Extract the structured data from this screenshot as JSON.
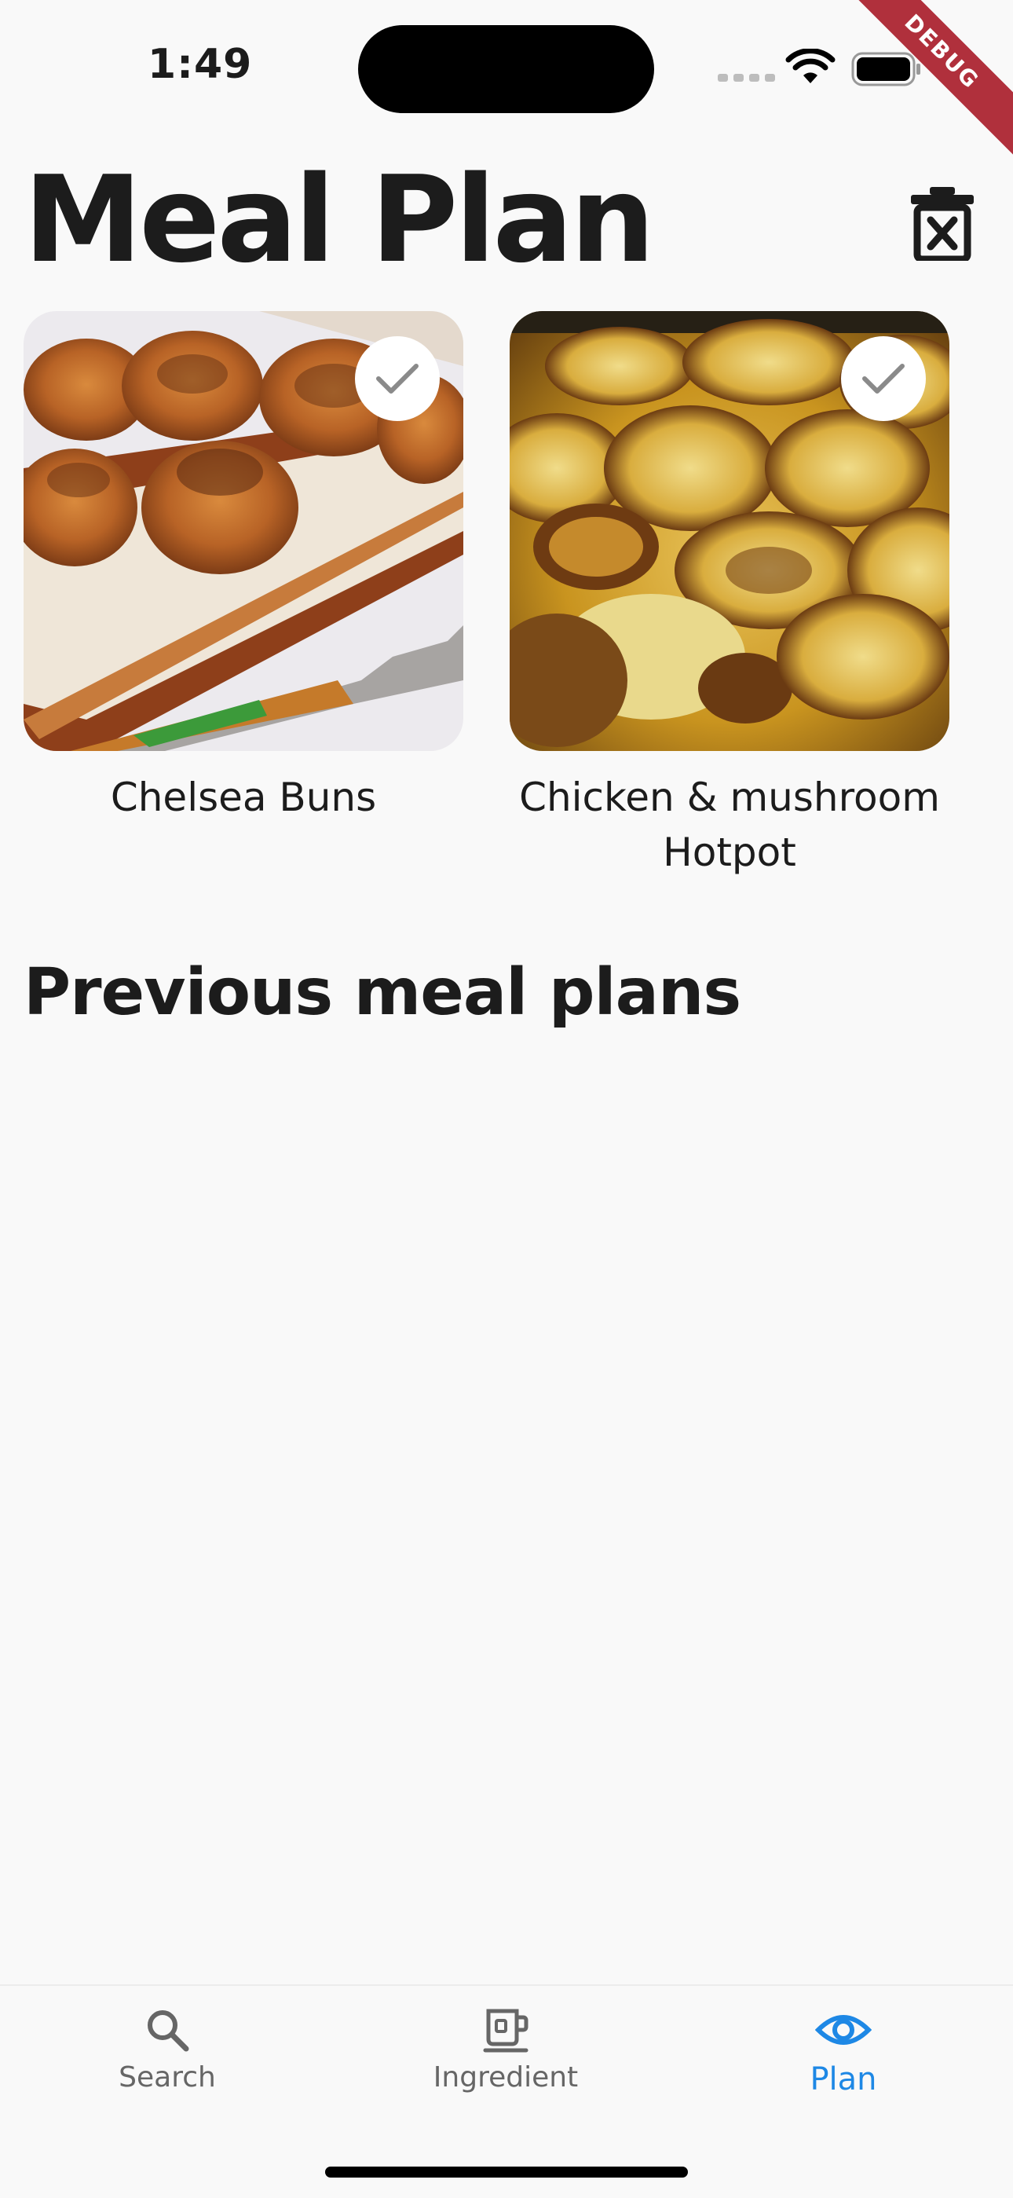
{
  "status_bar": {
    "time": "1:49",
    "debug_label": "DEBUG"
  },
  "header": {
    "title": "Meal Plan",
    "clear_icon": "trash-x-icon"
  },
  "meals": [
    {
      "name": "Chelsea Buns",
      "selected": true
    },
    {
      "name": "Chicken & mushroom Hotpot",
      "selected": true
    }
  ],
  "previous_section": {
    "title": "Previous meal plans"
  },
  "bottom_nav": {
    "items": [
      {
        "label": "Search",
        "icon": "search-icon",
        "active": false
      },
      {
        "label": "Ingredient",
        "icon": "mug-icon",
        "active": false
      },
      {
        "label": "Plan",
        "icon": "eye-icon",
        "active": true
      }
    ]
  },
  "colors": {
    "accent": "#1e88e5",
    "background": "#f9f9f9",
    "debug": "#b0303c"
  }
}
